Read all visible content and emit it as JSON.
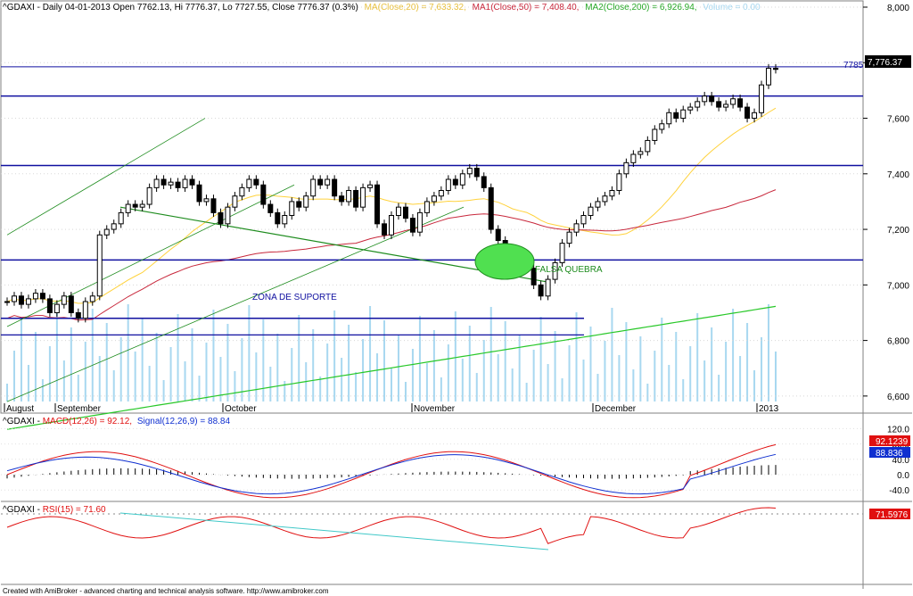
{
  "header": {
    "prefix": "^GDAXI - Daily 04-01-2013 Open 7762.13, Hi 7776.37, Lo 7727.55, Close 7776.37 (0.3%)",
    "ma20": "MA(Close,20) = 7,633.32,",
    "ma50": "MA1(Close,50) = 7,408.40,",
    "ma200": "MA2(Close,200) = 6,926.94,",
    "volume": "Volume = 0.00"
  },
  "colors": {
    "up_candle": "#ffffff",
    "down_candle": "#000000",
    "ma20": "#ffd23c",
    "ma50": "#c8283c",
    "ma200": "#28c828",
    "volume": "#a8d8f0",
    "support": "#1010a0",
    "trend_green": "#1e8c1e",
    "macd": "#e01010",
    "signal": "#1030d0",
    "rsi": "#e01010",
    "rsi_trend": "#40c8c8",
    "ellipse": "#50e050"
  },
  "annotations": {
    "zona": "ZONA DE SUPORTE",
    "falsa": "FALSA QUEBRA",
    "level_tag": "7785"
  },
  "macd_panel": {
    "title_prefix": "^GDAXI - ",
    "title_macd": "MACD(12,26) = 92.12,",
    "title_signal": "Signal(12,26,9) = 88.84",
    "ticks": [
      "120.0",
      "80.0",
      "40.0",
      "0.0",
      "-40.0"
    ],
    "value_macd": "92.1239",
    "value_signal": "88.836"
  },
  "rsi_panel": {
    "title_prefix": "^GDAXI - ",
    "title_rsi": "RSI(15) = 71.60",
    "value": "71.5976"
  },
  "footer": "Created with AmiBroker - advanced charting and technical analysis software. http://www.amibroker.com",
  "chart_data": {
    "type": "candlestick",
    "title": "^GDAXI - Daily 04-01-2013",
    "ylim": [
      6500,
      8000
    ],
    "yticks": [
      6600,
      6800,
      7000,
      7200,
      7400,
      7600,
      7800,
      8000
    ],
    "last_price": "7,776.37",
    "x_labels": [
      "August",
      "September",
      "October",
      "November",
      "December",
      "2013"
    ],
    "horizontal_levels": [
      7785,
      7680,
      7430,
      7090,
      6880,
      6820
    ],
    "trendline_rsi_flag": true,
    "close": [
      6940,
      6960,
      6930,
      6950,
      6970,
      6950,
      6900,
      6930,
      6960,
      6900,
      6880,
      6940,
      6960,
      7180,
      7200,
      7220,
      7260,
      7290,
      7280,
      7290,
      7350,
      7380,
      7360,
      7370,
      7350,
      7380,
      7360,
      7300,
      7310,
      7260,
      7220,
      7280,
      7320,
      7350,
      7380,
      7360,
      7290,
      7260,
      7220,
      7250,
      7300,
      7280,
      7320,
      7380,
      7360,
      7380,
      7320,
      7300,
      7340,
      7280,
      7350,
      7360,
      7220,
      7180,
      7250,
      7280,
      7240,
      7190,
      7260,
      7300,
      7320,
      7340,
      7380,
      7360,
      7400,
      7420,
      7390,
      7350,
      7200,
      7160,
      7130,
      7110,
      7080,
      7060,
      7000,
      6960,
      7020,
      7080,
      7150,
      7190,
      7220,
      7250,
      7280,
      7300,
      7320,
      7340,
      7400,
      7440,
      7470,
      7480,
      7520,
      7560,
      7580,
      7620,
      7600,
      7630,
      7640,
      7660,
      7680,
      7660,
      7640,
      7650,
      7670,
      7640,
      7600,
      7620,
      7720,
      7780,
      7776
    ]
  }
}
